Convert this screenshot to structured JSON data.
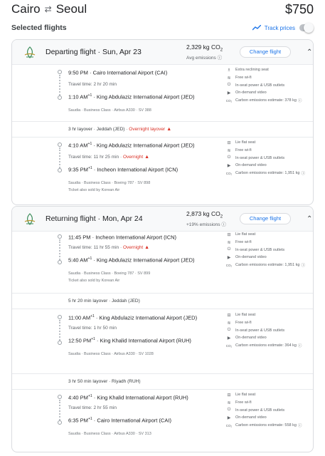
{
  "header": {
    "origin": "Cairo",
    "destination": "Seoul",
    "swap_icon": "swap-arrows-icon",
    "price": "$750"
  },
  "selected": {
    "title": "Selected flights",
    "track_prices_label": "Track prices",
    "track_enabled": false
  },
  "departing": {
    "title": "Departing flight · Sun, Apr 23",
    "emissions": "2,329 kg CO",
    "emissions_sub": "2",
    "emissions_note": "Avg emissions",
    "change_label": "Change flight",
    "segments": [
      {
        "dep_time": "9:50 PM",
        "dep_sup": "",
        "dep_airport": "Cairo International Airport (CAI)",
        "travel": "Travel time: 2 hr 20 min",
        "travel_warn": "",
        "arr_time": "1:10 AM",
        "arr_sup": "+1",
        "arr_airport": "King Abdulaziz International Airport (JED)",
        "meta1": "Saudia · Business Class · Airbus A330 · SV 388",
        "meta2": "",
        "amenities": [
          {
            "icon": "reclining-seat-icon",
            "glyph": "♿",
            "label": "Extra reclining seat"
          },
          {
            "icon": "wifi-icon",
            "glyph": "≋",
            "label": "Free wi-fi"
          },
          {
            "icon": "power-outlet-icon",
            "glyph": "⏻",
            "label": "In-seat power & USB outlets"
          },
          {
            "icon": "video-icon",
            "glyph": "▶",
            "label": "On-demand video"
          },
          {
            "icon": "co2-icon",
            "glyph": "CO₂",
            "label": "Carbon emissions estimate: 378 kg"
          }
        ]
      },
      {
        "dep_time": "4:10 AM",
        "dep_sup": "+1",
        "dep_airport": "King Abdulaziz International Airport (JED)",
        "travel": "Travel time: 11 hr 25 min · ",
        "travel_warn": "Overnight",
        "arr_time": "9:35 PM",
        "arr_sup": "+1",
        "arr_airport": "Incheon International Airport (ICN)",
        "meta1": "Saudia · Business Class · Boeing 787 · SV 898",
        "meta2": "Ticket also sold by Korean Air",
        "amenities": [
          {
            "icon": "flat-seat-icon",
            "glyph": "⊟",
            "label": "Lie flat seat"
          },
          {
            "icon": "wifi-icon",
            "glyph": "≋",
            "label": "Free wi-fi"
          },
          {
            "icon": "power-outlet-icon",
            "glyph": "⏻",
            "label": "In-seat power & USB outlets"
          },
          {
            "icon": "video-icon",
            "glyph": "▶",
            "label": "On-demand video"
          },
          {
            "icon": "co2-icon",
            "glyph": "CO₂",
            "label": "Carbon emissions estimate: 1,951 kg"
          }
        ]
      }
    ],
    "layover": {
      "text": "3 hr layover · Jeddah (JED) · ",
      "warn": "Overnight layover"
    }
  },
  "returning": {
    "title": "Returning flight · Mon, Apr 24",
    "emissions": "2,873 kg CO",
    "emissions_sub": "2",
    "emissions_note": "+19% emissions",
    "change_label": "Change flight",
    "segments": [
      {
        "dep_time": "11:45 PM",
        "dep_sup": "",
        "dep_airport": "Incheon International Airport (ICN)",
        "travel": "Travel time: 11 hr 55 min · ",
        "travel_warn": "Overnight",
        "arr_time": "5:40 AM",
        "arr_sup": "+1",
        "arr_airport": "King Abdulaziz International Airport (JED)",
        "meta1": "Saudia · Business Class · Boeing 787 · SV 899",
        "meta2": "Ticket also sold by Korean Air",
        "amenities": [
          {
            "icon": "flat-seat-icon",
            "glyph": "⊟",
            "label": "Lie flat seat"
          },
          {
            "icon": "wifi-icon",
            "glyph": "≋",
            "label": "Free wi-fi"
          },
          {
            "icon": "power-outlet-icon",
            "glyph": "⏻",
            "label": "In-seat power & USB outlets"
          },
          {
            "icon": "video-icon",
            "glyph": "▶",
            "label": "On-demand video"
          },
          {
            "icon": "co2-icon",
            "glyph": "CO₂",
            "label": "Carbon emissions estimate: 1,951 kg"
          }
        ]
      },
      {
        "dep_time": "11:00 AM",
        "dep_sup": "+1",
        "dep_airport": "King Abdulaziz International Airport (JED)",
        "travel": "Travel time: 1 hr 50 min",
        "travel_warn": "",
        "arr_time": "12:50 PM",
        "arr_sup": "+1",
        "arr_airport": "King Khalid International Airport (RUH)",
        "meta1": "Saudia · Business Class · Airbus A330 · SV 1028",
        "meta2": "",
        "amenities": [
          {
            "icon": "flat-seat-icon",
            "glyph": "⊟",
            "label": "Lie flat seat"
          },
          {
            "icon": "wifi-icon",
            "glyph": "≋",
            "label": "Free wi-fi"
          },
          {
            "icon": "power-outlet-icon",
            "glyph": "⏻",
            "label": "In-seat power & USB outlets"
          },
          {
            "icon": "video-icon",
            "glyph": "▶",
            "label": "On-demand video"
          },
          {
            "icon": "co2-icon",
            "glyph": "CO₂",
            "label": "Carbon emissions estimate: 364 kg"
          }
        ]
      },
      {
        "dep_time": "4:40 PM",
        "dep_sup": "+1",
        "dep_airport": "King Khalid International Airport (RUH)",
        "travel": "Travel time: 2 hr 55 min",
        "travel_warn": "",
        "arr_time": "6:35 PM",
        "arr_sup": "+1",
        "arr_airport": "Cairo International Airport (CAI)",
        "meta1": "Saudia · Business Class · Airbus A330 · SV 313",
        "meta2": "",
        "amenities": [
          {
            "icon": "flat-seat-icon",
            "glyph": "⊟",
            "label": "Lie flat seat"
          },
          {
            "icon": "wifi-icon",
            "glyph": "≋",
            "label": "Free wi-fi"
          },
          {
            "icon": "power-outlet-icon",
            "glyph": "⏻",
            "label": "In-seat power & USB outlets"
          },
          {
            "icon": "video-icon",
            "glyph": "▶",
            "label": "On-demand video"
          },
          {
            "icon": "co2-icon",
            "glyph": "CO₂",
            "label": "Carbon emissions estimate: 558 kg"
          }
        ]
      }
    ],
    "layovers": [
      {
        "text": "5 hr 20 min layover · Jeddah (JED)",
        "warn": ""
      },
      {
        "text": "3 hr 50 min layover · Riyadh (RUH)",
        "warn": ""
      }
    ]
  },
  "colors": {
    "accent": "#1a73e8",
    "warning": "#d93025",
    "airline_logo": "#3c8d5a"
  }
}
